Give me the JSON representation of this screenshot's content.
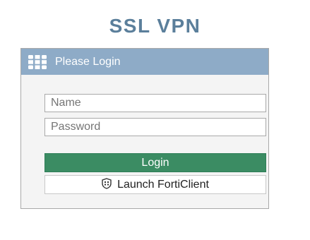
{
  "app": {
    "title": "SSL VPN"
  },
  "panel": {
    "title": "Please Login"
  },
  "form": {
    "name_placeholder": "Name",
    "name_value": "",
    "password_placeholder": "Password",
    "password_value": "",
    "login_label": "Login",
    "forticlient_label": "Launch FortiClient"
  },
  "icons": {
    "logo": "fortinet-logo-icon",
    "forticlient": "forticlient-shield-icon"
  },
  "colors": {
    "title": "#5b7f9b",
    "header_bg": "#8eabc7",
    "panel_bg": "#f4f4f4",
    "login_button": "#3b8c63"
  }
}
